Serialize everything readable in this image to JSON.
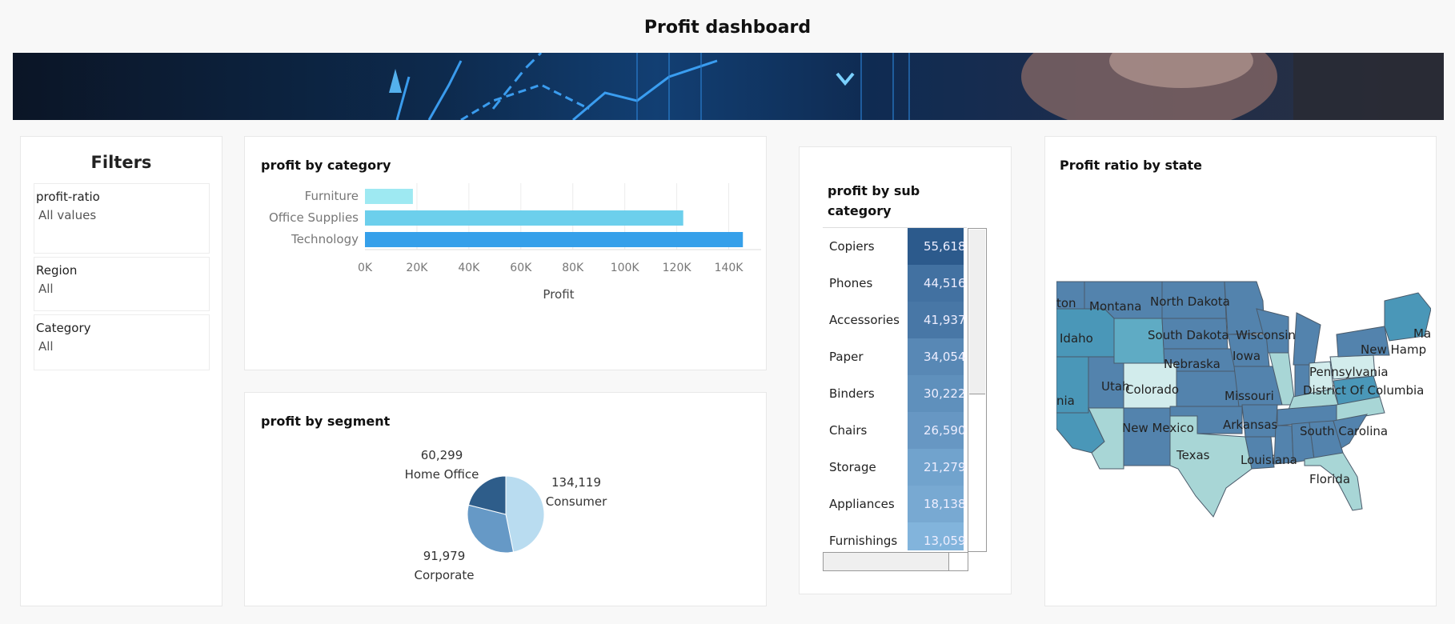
{
  "dashboard": {
    "title": "Profit dashboard"
  },
  "filters": {
    "title": "Filters",
    "items": [
      {
        "label": "profit-ratio",
        "value": "All values"
      },
      {
        "label": "Region",
        "value": "All"
      },
      {
        "label": "Category",
        "value": "All"
      }
    ]
  },
  "chart_data": [
    {
      "id": "profit-by-category",
      "type": "bar",
      "orientation": "horizontal",
      "title": "profit by category",
      "categories": [
        "Furniture",
        "Office Supplies",
        "Technology"
      ],
      "values": [
        18451,
        122491,
        145455
      ],
      "colors": [
        "#9ee9f2",
        "#6ccfec",
        "#36a0ea"
      ],
      "xlabel": "Profit",
      "xlim": [
        0,
        150000
      ],
      "xticks": [
        "0K",
        "20K",
        "40K",
        "60K",
        "80K",
        "100K",
        "120K",
        "140K"
      ],
      "grid": true
    },
    {
      "id": "profit-by-segment",
      "type": "pie",
      "title": "profit by segment",
      "categories": [
        "Consumer",
        "Corporate",
        "Home Office"
      ],
      "values": [
        134119,
        91979,
        60299
      ],
      "value_labels": [
        "134,119",
        "91,979",
        "60,299"
      ],
      "colors": [
        "#b9dcf0",
        "#6699c6",
        "#2e5d8a"
      ]
    },
    {
      "id": "profit-by-sub-category",
      "type": "table",
      "title": "profit by sub category",
      "categories": [
        "Copiers",
        "Phones",
        "Accessories",
        "Paper",
        "Binders",
        "Chairs",
        "Storage",
        "Appliances",
        "Furnishings"
      ],
      "value_labels": [
        "55,618",
        "44,516",
        "41,937",
        "34,054",
        "30,222",
        "26,590",
        "21,279",
        "18,138",
        "13,059"
      ],
      "values": [
        55618,
        44516,
        41937,
        34054,
        30222,
        26590,
        21279,
        18138,
        13059
      ]
    }
  ],
  "map": {
    "title": "Profit ratio by state",
    "labels": [
      "Montana",
      "North Dakota",
      "South Dakota",
      "Wisconsin",
      "Idaho",
      "Nebraska",
      "Iowa",
      "Utah",
      "Colorado",
      "Missouri",
      "Pennsylvania",
      "District Of Columbia",
      "New Mexico",
      "Arkansas",
      "South Carolina",
      "Texas",
      "Louisiana",
      "Florida",
      "New Hamp",
      "Ma",
      "ton",
      "nia"
    ]
  },
  "colors": {
    "map_dark": "#5383ad",
    "map_teal": "#4a97b8",
    "map_light": "#a8d6d6"
  }
}
